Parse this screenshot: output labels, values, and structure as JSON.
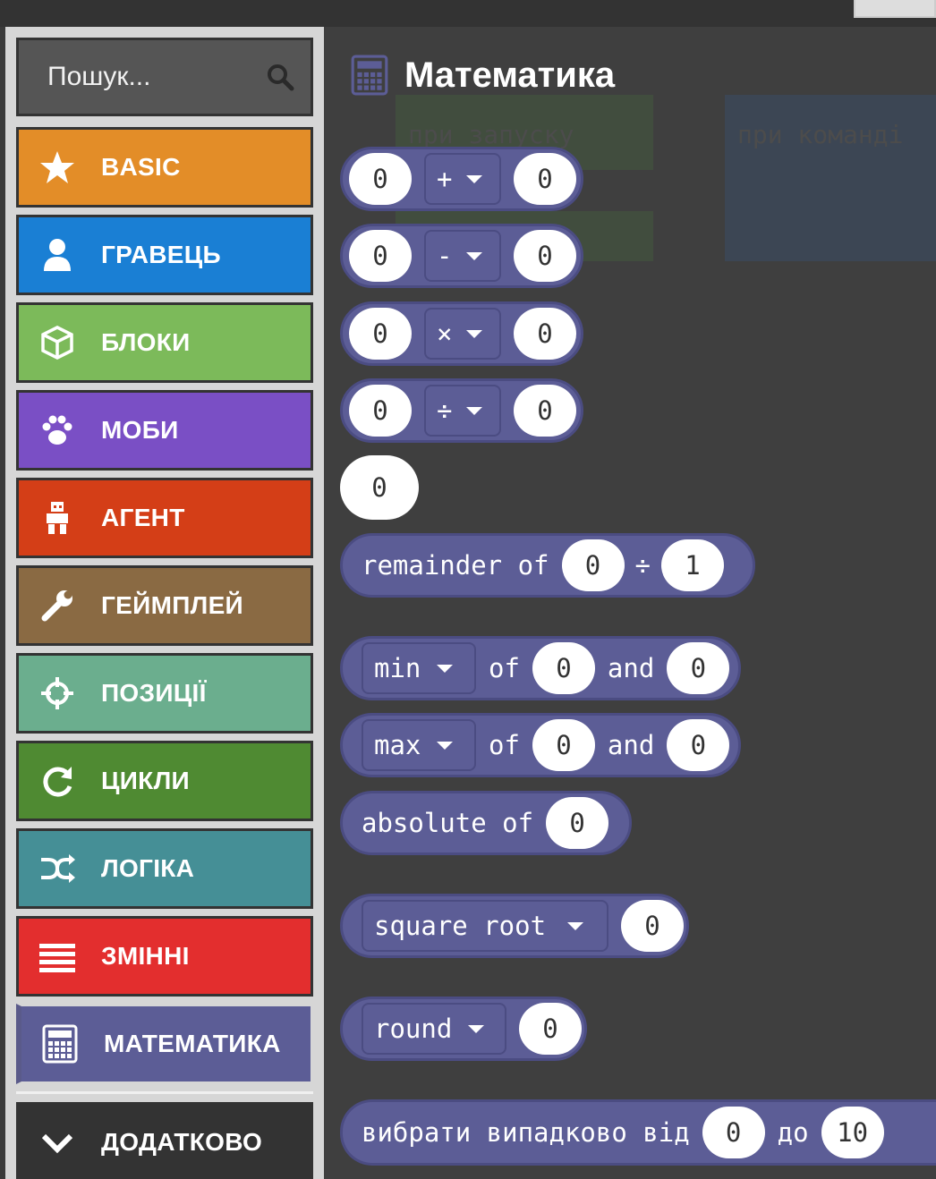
{
  "search": {
    "placeholder": "Пошук..."
  },
  "categories": [
    {
      "label": "BASIC",
      "color": "#e38d28",
      "icon": "star-icon"
    },
    {
      "label": "ГРАВЕЦЬ",
      "color": "#1a7fd4",
      "icon": "person-icon"
    },
    {
      "label": "БЛОКИ",
      "color": "#7cba5a",
      "icon": "cube-icon"
    },
    {
      "label": "МОБИ",
      "color": "#7a4fc5",
      "icon": "paw-icon"
    },
    {
      "label": "АГЕНТ",
      "color": "#d43e17",
      "icon": "agent-icon"
    },
    {
      "label": "ГЕЙМПЛЕЙ",
      "color": "#8a6a43",
      "icon": "wrench-icon"
    },
    {
      "label": "ПОЗИЦІЇ",
      "color": "#6bae8e",
      "icon": "crosshair-icon"
    },
    {
      "label": "ЦИКЛИ",
      "color": "#4f8a32",
      "icon": "loop-icon"
    },
    {
      "label": "ЛОГІКА",
      "color": "#458f96",
      "icon": "shuffle-icon"
    },
    {
      "label": "ЗМІННІ",
      "color": "#e32e2e",
      "icon": "list-icon"
    },
    {
      "label": "МАТЕМАТИКА",
      "color": "#5c5d96",
      "icon": "calculator-icon"
    },
    {
      "label": "ДОДАТКОВО",
      "color": "#333333",
      "icon": "chevron-down-icon"
    }
  ],
  "flyout": {
    "title": "Математика",
    "ghost_labels": [
      "при запуску",
      "при команді"
    ],
    "blocks": {
      "add": {
        "a": "0",
        "op": "+",
        "b": "0"
      },
      "sub": {
        "a": "0",
        "op": "-",
        "b": "0"
      },
      "mul": {
        "a": "0",
        "op": "×",
        "b": "0"
      },
      "div": {
        "a": "0",
        "op": "÷",
        "b": "0"
      },
      "number": "0",
      "remainder": {
        "label": "remainder of",
        "a": "0",
        "op": "÷",
        "b": "1"
      },
      "min": {
        "fn": "min",
        "of": "of",
        "a": "0",
        "and": "and",
        "b": "0"
      },
      "max": {
        "fn": "max",
        "of": "of",
        "a": "0",
        "and": "and",
        "b": "0"
      },
      "absolute": {
        "label": "absolute of",
        "a": "0"
      },
      "sqrt": {
        "fn": "square root",
        "a": "0"
      },
      "round": {
        "fn": "round",
        "a": "0"
      },
      "random": {
        "label": "вибрати випадково від",
        "a": "0",
        "to": "до",
        "b": "10"
      }
    }
  }
}
